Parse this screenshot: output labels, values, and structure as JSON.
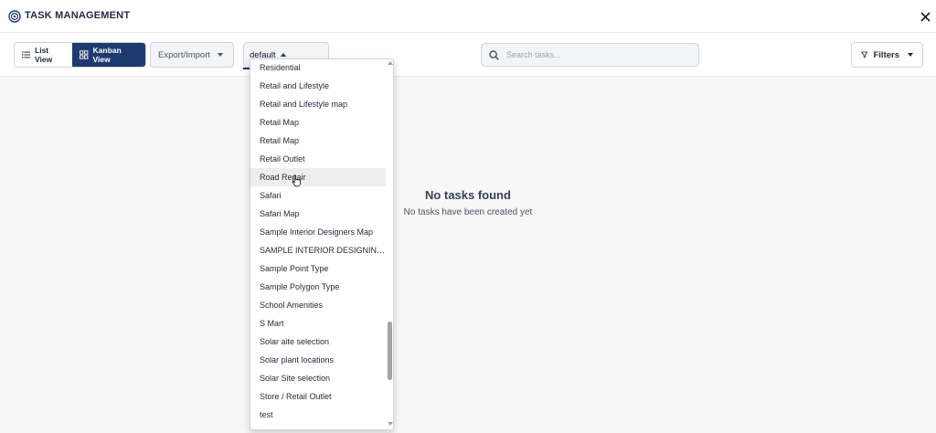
{
  "app": {
    "title": "TASK MANAGEMENT"
  },
  "toolbar": {
    "list_view_label": "List View",
    "kanban_view_label": "Kanban View",
    "active_view": "Kanban View",
    "export_label": "Export/Import",
    "layer_select_value": "default",
    "search_placeholder": "Search tasks...",
    "filters_label": "Filters"
  },
  "dropdown": {
    "hovered_item": "Road Repair",
    "items": [
      "Residential",
      "Retail and Lifestyle",
      "Retail and Lifestyle map",
      "Retail Map",
      "Retail Map",
      "Retail Outlet",
      "Road Repair",
      "Safari",
      "Safari Map",
      "Sample Interior Designers Map",
      "SAMPLE INTERIOR DESIGNING...",
      "Sample Point Type",
      "Sample Polygon Type",
      "School Amenities",
      "S Mart",
      "Solar aite selection",
      "Solar plant locations",
      "Solar Site selection",
      "Store / Retail Outlet",
      "test"
    ]
  },
  "empty_state": {
    "title": "No tasks found",
    "subtitle": "No tasks have been created yet"
  },
  "colors": {
    "accent": "#1e3a6e",
    "hover_row": "#eeeeee",
    "background": "#f7f7f8"
  },
  "icons": {
    "logo": "target-logo-icon",
    "close": "close-icon",
    "list": "list-icon",
    "kanban": "grid-icon",
    "search": "search-icon",
    "filter": "funnel-icon"
  }
}
